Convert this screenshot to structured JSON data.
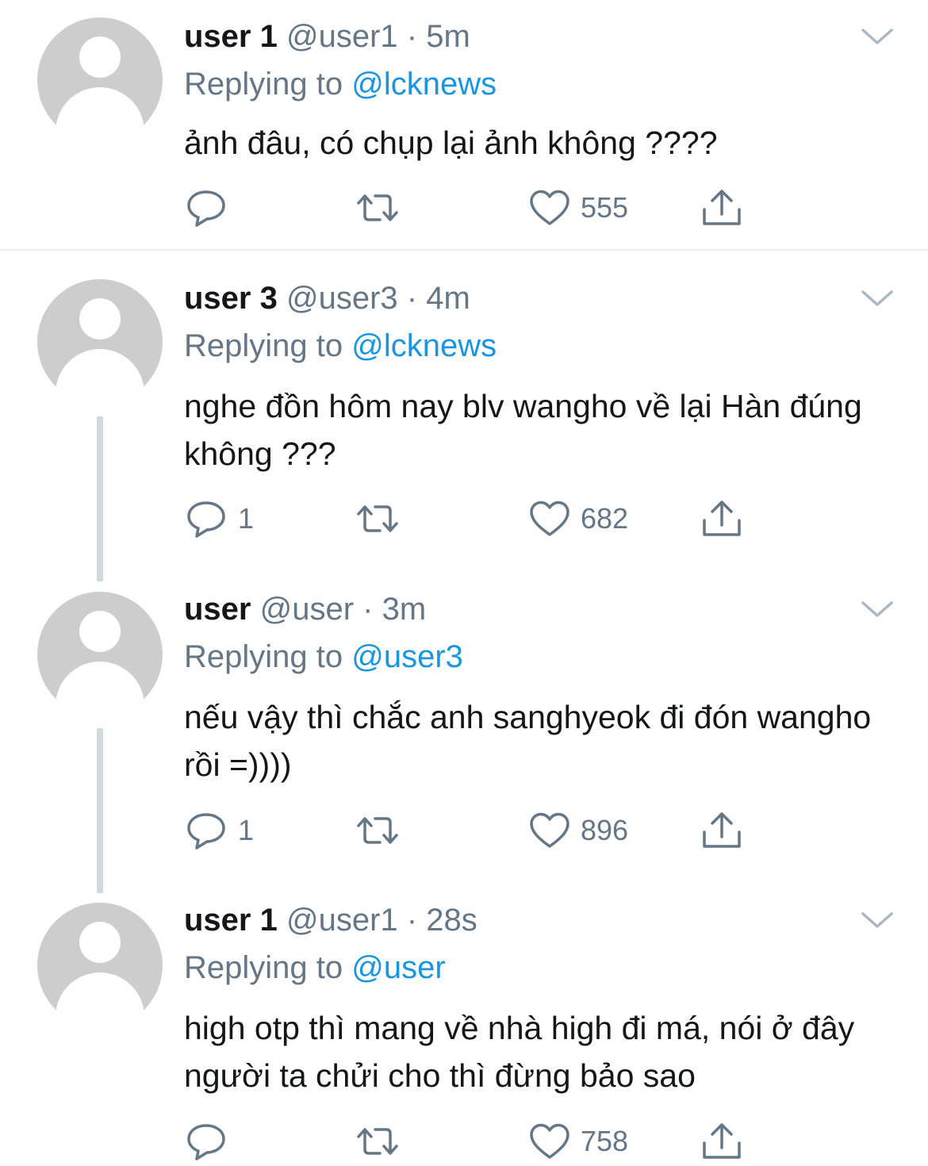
{
  "replying_label": "Replying to",
  "tweets": [
    {
      "name": "user 1",
      "handle": "@user1",
      "dot": "·",
      "time": "5m",
      "reply_to": "@lcknews",
      "text": "ảnh đâu, có chụp lại ảnh không ????",
      "reply_count": "",
      "retweet_count": "",
      "like_count": "555"
    },
    {
      "name": "user 3",
      "handle": "@user3",
      "dot": "·",
      "time": "4m",
      "reply_to": "@lcknews",
      "text": "nghe đồn hôm nay blv wangho về lại Hàn đúng không ???",
      "reply_count": "1",
      "retweet_count": "",
      "like_count": "682"
    },
    {
      "name": "user",
      "handle": "@user",
      "dot": "·",
      "time": "3m",
      "reply_to": "@user3",
      "text": "nếu vậy thì chắc anh sanghyeok đi đón wangho rồi =))))",
      "reply_count": "1",
      "retweet_count": "",
      "like_count": "896"
    },
    {
      "name": "user 1",
      "handle": "@user1",
      "dot": "·",
      "time": "28s",
      "reply_to": "@user",
      "text": "high otp thì mang về nhà high đi má, nói ở đây người ta chửi cho thì đừng bảo sao",
      "reply_count": "",
      "retweet_count": "",
      "like_count": "758"
    }
  ],
  "colors": {
    "name": "#14171a",
    "secondary": "#657786",
    "mention": "#1b95e0",
    "avatar": "#cdcdcd",
    "thread_line": "#cfd9de",
    "divider": "#e6ecf0"
  },
  "icons": [
    "reply-icon",
    "retweet-icon",
    "like-icon",
    "share-icon",
    "chevron-down-icon",
    "default-avatar-icon"
  ]
}
